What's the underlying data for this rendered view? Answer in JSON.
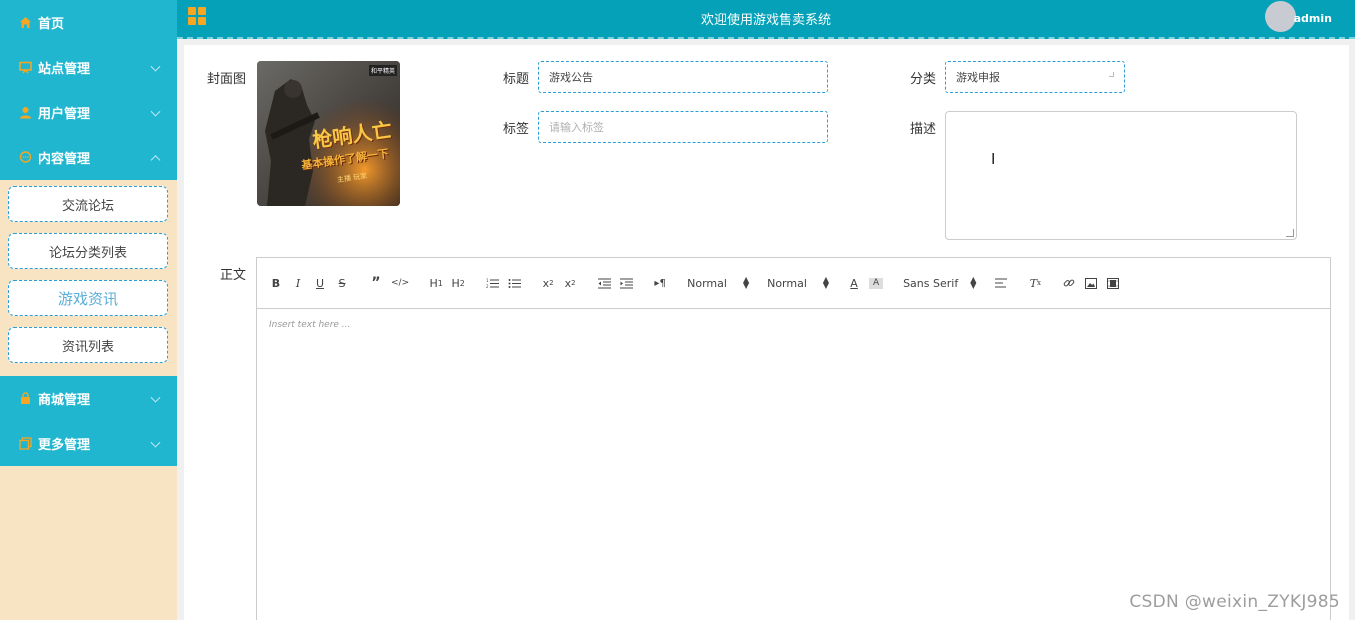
{
  "header": {
    "title": "欢迎使用游戏售卖系统",
    "username": "admin"
  },
  "sidebar": {
    "items": [
      {
        "label": "首页",
        "icon": "home-icon"
      },
      {
        "label": "站点管理",
        "icon": "monitor-icon"
      },
      {
        "label": "用户管理",
        "icon": "user-icon"
      },
      {
        "label": "内容管理",
        "icon": "chat-icon"
      },
      {
        "label": "商城管理",
        "icon": "shopping-bag-icon"
      },
      {
        "label": "更多管理",
        "icon": "copy-icon"
      }
    ],
    "submenu": [
      "交流论坛",
      "论坛分类列表",
      "游戏资讯",
      "资讯列表"
    ]
  },
  "form": {
    "cover_label": "封面图",
    "title_label": "标题",
    "title_value": "游戏公告",
    "tag_label": "标签",
    "tag_placeholder": "请输入标签",
    "category_label": "分类",
    "category_value": "游戏申报",
    "desc_label": "描述",
    "body_label": "正文"
  },
  "editor": {
    "header_picker": "Normal",
    "size_picker": "Normal",
    "font_picker": "Sans Serif",
    "placeholder": "Insert text here ..."
  },
  "cover_image": {
    "text_line1": "枪响人亡",
    "text_line2": "基本操作了解一下",
    "text_line3": "主播 玩家",
    "corner_badge": "和平精英"
  },
  "watermark": "CSDN @weixin_ZYKJ985",
  "colors": {
    "sidebar_item": "#21b6cf",
    "header": "#04a1b8",
    "sidebar_bg": "#f8e3c3",
    "accent_orange": "#f5a623",
    "field_border": "#2a9ed6"
  }
}
